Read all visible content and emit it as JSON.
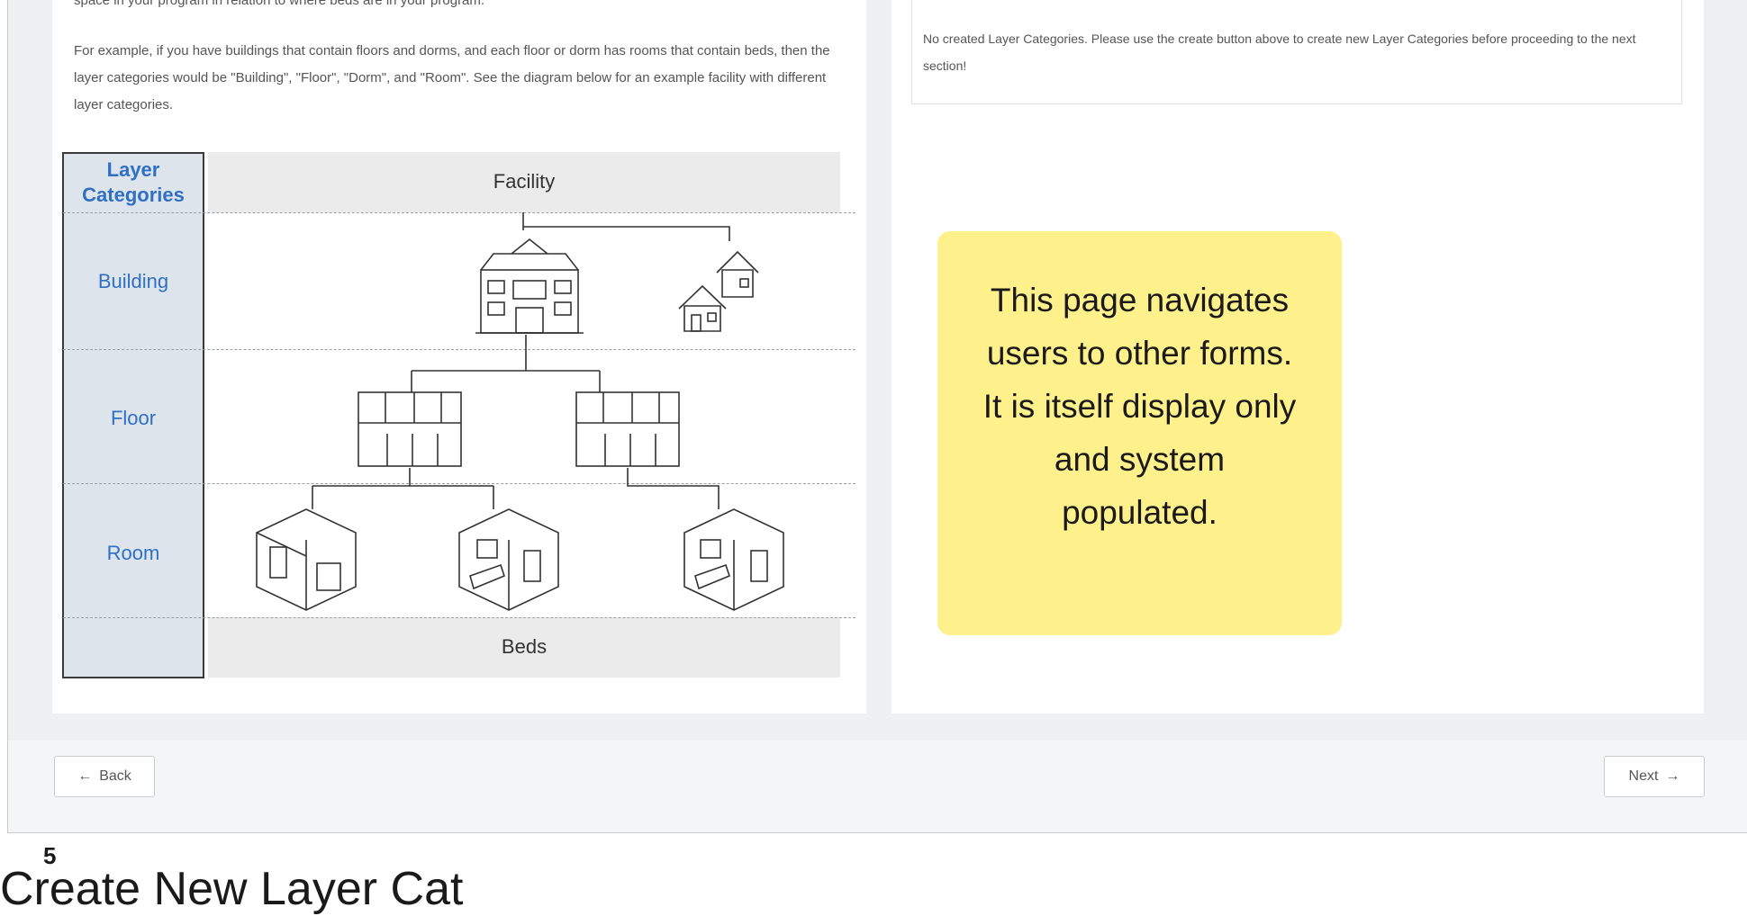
{
  "intro": {
    "line1": "space in your program in relation to where beds are in your program.",
    "paragraph2": "For example, if you have buildings that contain floors and dorms, and each floor or dorm has rooms that contain beds, then the layer categories would be \"Building\", \"Floor\", \"Dorm\", and \"Room\". See the diagram below for an example facility with different layer categories."
  },
  "diagram": {
    "column_header": "Layer Categories",
    "top_band": "Facility",
    "bottom_band": "Beds",
    "categories": [
      "Building",
      "Floor",
      "Room"
    ]
  },
  "right_panel": {
    "empty_message": "No created Layer Categories. Please use the create button above to create new Layer Categories before proceeding to the next section!"
  },
  "sticky_note": {
    "text": "This page navigates users to other forms. It is itself display only and system populated."
  },
  "footer": {
    "back_label": "Back",
    "next_label": "Next"
  },
  "bottom_caption": {
    "number": "5",
    "title": "Create New Layer Cat"
  }
}
